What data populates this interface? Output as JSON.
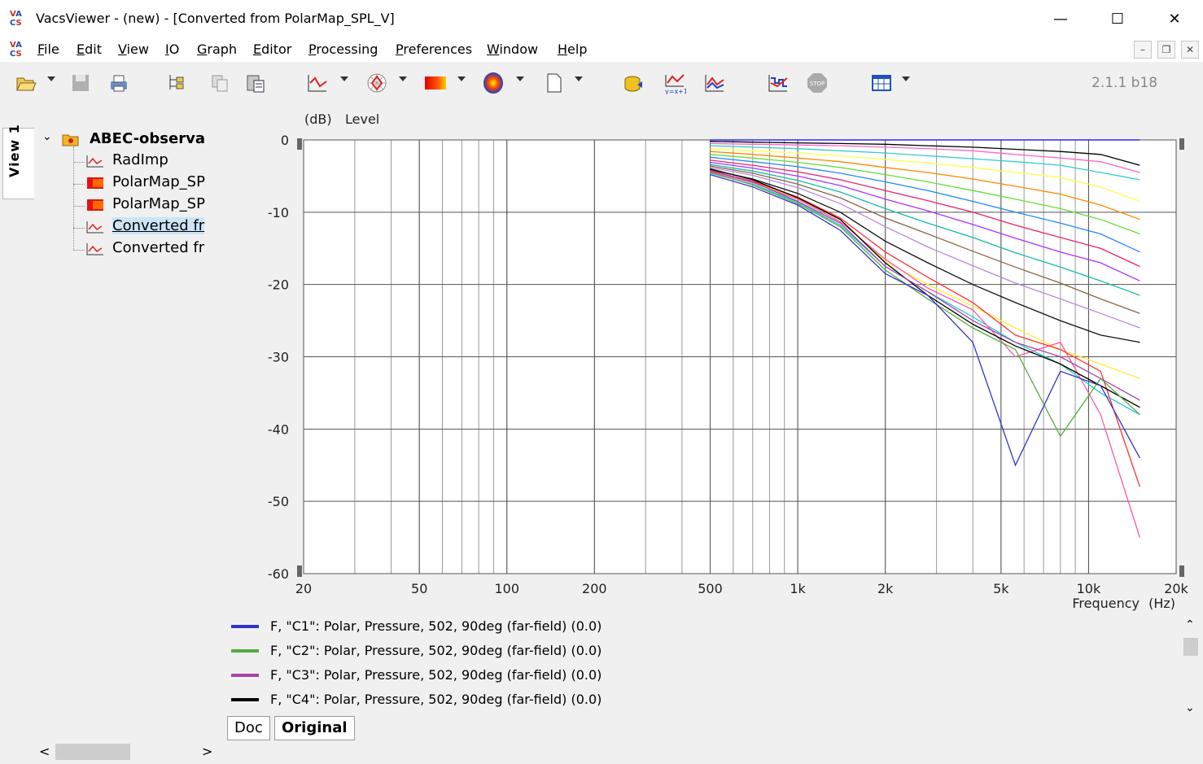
{
  "window": {
    "title": "VacsViewer - (new) - [Converted from PolarMap_SPL_V]",
    "minimize": "—",
    "maximize": "☐",
    "close": "✕"
  },
  "menu": [
    "File",
    "Edit",
    "View",
    "IO",
    "Graph",
    "Editor",
    "Processing",
    "Preferences",
    "Window",
    "Help"
  ],
  "menu_mnemonics": [
    "F",
    "E",
    "V",
    "I",
    "G",
    "E",
    "P",
    "P",
    "W",
    "H"
  ],
  "version": "2.1.1 b18",
  "sidebar": {
    "view_tab": "View 1",
    "tree": [
      {
        "label": "ABEC-observa",
        "type": "folder",
        "selected": false,
        "level": 0
      },
      {
        "label": "RadImp",
        "type": "graph",
        "selected": false,
        "level": 1
      },
      {
        "label": "PolarMap_SP",
        "type": "map",
        "selected": false,
        "level": 1
      },
      {
        "label": "PolarMap_SP",
        "type": "map",
        "selected": false,
        "level": 1
      },
      {
        "label": "Converted fr",
        "type": "graph",
        "selected": true,
        "level": 1
      },
      {
        "label": "Converted fr",
        "type": "graph",
        "selected": false,
        "level": 1
      }
    ]
  },
  "chart_data": {
    "type": "line",
    "ylabel_unit": "(dB)",
    "ylabel": "Level",
    "xlabel": "Frequency",
    "xlabel_unit": "(Hz)",
    "xscale": "log",
    "xlim": [
      20,
      20000
    ],
    "ylim": [
      -60,
      0
    ],
    "x_ticks": [
      "20",
      "50",
      "100",
      "200",
      "500",
      "1k",
      "2k",
      "5k",
      "10k",
      "20k"
    ],
    "x_tick_values": [
      20,
      50,
      100,
      200,
      500,
      1000,
      2000,
      5000,
      10000,
      20000
    ],
    "y_ticks": [
      "0",
      "-10",
      "-20",
      "-30",
      "-40",
      "-50",
      "-60"
    ],
    "y_tick_values": [
      0,
      -10,
      -20,
      -30,
      -40,
      -50,
      -60
    ],
    "grid": true,
    "x": [
      500,
      700,
      1000,
      1400,
      2000,
      2800,
      4000,
      5600,
      8000,
      11000,
      15000
    ],
    "series": [
      {
        "name": "F, \"C1\": Polar, Pressure, 502, 90deg (far-field) (0.0)",
        "color": "#3333cc",
        "values": [
          -4.8,
          -6.5,
          -9.0,
          -12.5,
          -18.5,
          -21.5,
          -28.0,
          -45.0,
          -32.0,
          -34.0,
          -44.0
        ]
      },
      {
        "name": "F, \"C2\": Polar, Pressure, 502, 90deg (far-field) (0.0)",
        "color": "#55aa44",
        "values": [
          -4.5,
          -6.2,
          -8.8,
          -12.0,
          -18.0,
          -22.0,
          -26.0,
          -29.0,
          -41.0,
          -33.0,
          -38.0
        ]
      },
      {
        "name": "F, \"C3\": Polar, Pressure, 502, 90deg (far-field) (0.0)",
        "color": "#aa44aa",
        "values": [
          -4.2,
          -5.8,
          -8.5,
          -11.5,
          -17.5,
          -21.0,
          -25.0,
          -28.0,
          -30.0,
          -33.0,
          -36.0
        ]
      },
      {
        "name": "F, \"C4\": Polar, Pressure, 502, 90deg (far-field) (0.0)",
        "color": "#000000",
        "values": [
          -4.0,
          -5.5,
          -8.0,
          -11.0,
          -17.0,
          -21.5,
          -25.5,
          -28.5,
          -31.0,
          -34.0,
          -37.0
        ]
      },
      {
        "name": "",
        "color": "#0000ff",
        "values": [
          0,
          0,
          0,
          0,
          0,
          0,
          0,
          0,
          0,
          0,
          0
        ]
      },
      {
        "name": "",
        "color": "#000000",
        "values": [
          -0.2,
          -0.3,
          -0.4,
          -0.5,
          -0.6,
          -0.8,
          -1.0,
          -1.3,
          -1.6,
          -2.0,
          -3.5
        ]
      },
      {
        "name": "",
        "color": "#ff66cc",
        "values": [
          -0.5,
          -0.6,
          -0.7,
          -0.8,
          -1.0,
          -1.2,
          -1.5,
          -2.0,
          -2.5,
          -3.0,
          -4.5
        ]
      },
      {
        "name": "",
        "color": "#33cccc",
        "values": [
          -0.8,
          -1.0,
          -1.2,
          -1.5,
          -1.8,
          -2.2,
          -2.6,
          -3.0,
          -3.5,
          -4.5,
          -5.5
        ]
      },
      {
        "name": "",
        "color": "#ffff44",
        "values": [
          -1.2,
          -1.5,
          -1.8,
          -2.2,
          -2.7,
          -3.2,
          -3.8,
          -4.5,
          -5.2,
          -6.5,
          -8.5
        ]
      },
      {
        "name": "",
        "color": "#ff8800",
        "values": [
          -1.6,
          -2.0,
          -2.5,
          -3.0,
          -3.8,
          -4.5,
          -5.4,
          -6.4,
          -7.5,
          -9.0,
          -11.0
        ]
      },
      {
        "name": "",
        "color": "#66dd33",
        "values": [
          -2.0,
          -2.5,
          -3.1,
          -3.8,
          -4.8,
          -5.8,
          -7.0,
          -8.2,
          -9.5,
          -11.0,
          -13.0
        ]
      },
      {
        "name": "",
        "color": "#2288ff",
        "values": [
          -2.4,
          -3.0,
          -3.7,
          -4.6,
          -5.8,
          -7.0,
          -8.5,
          -10.0,
          -11.5,
          -13.0,
          -15.5
        ]
      },
      {
        "name": "",
        "color": "#ee2266",
        "values": [
          -2.8,
          -3.5,
          -4.4,
          -5.5,
          -7.0,
          -8.4,
          -10.0,
          -11.8,
          -13.5,
          -15.0,
          -17.5
        ]
      },
      {
        "name": "",
        "color": "#aa33ff",
        "values": [
          -3.1,
          -3.9,
          -5.0,
          -6.3,
          -8.2,
          -9.8,
          -11.7,
          -13.6,
          -15.5,
          -17.0,
          -19.5
        ]
      },
      {
        "name": "",
        "color": "#11bbaa",
        "values": [
          -3.4,
          -4.3,
          -5.6,
          -7.2,
          -9.5,
          -11.5,
          -13.5,
          -15.6,
          -17.6,
          -19.5,
          -21.5
        ]
      },
      {
        "name": "",
        "color": "#886644",
        "values": [
          -3.6,
          -4.6,
          -6.1,
          -8.0,
          -10.8,
          -13.0,
          -15.4,
          -17.6,
          -19.8,
          -22.0,
          -24.0
        ]
      },
      {
        "name": "",
        "color": "#bb88dd",
        "values": [
          -3.8,
          -4.9,
          -6.6,
          -8.8,
          -12.0,
          -14.8,
          -17.4,
          -19.8,
          -22.0,
          -24.0,
          -26.0
        ]
      },
      {
        "name": "",
        "color": "#111111",
        "values": [
          -4.1,
          -5.4,
          -7.4,
          -10.0,
          -14.0,
          -17.0,
          -20.0,
          -22.5,
          -25.0,
          -27.0,
          -28.0
        ]
      },
      {
        "name": "",
        "color": "#ff3333",
        "values": [
          -4.3,
          -5.7,
          -7.9,
          -10.8,
          -15.5,
          -19.0,
          -22.5,
          -27.0,
          -29.0,
          -32.0,
          -48.0
        ]
      },
      {
        "name": "",
        "color": "#ff55aa",
        "values": [
          -4.4,
          -5.9,
          -8.2,
          -11.3,
          -16.5,
          -20.5,
          -23.5,
          -30.0,
          -28.0,
          -38.0,
          -55.0
        ]
      },
      {
        "name": "",
        "color": "#22cccc",
        "values": [
          -4.6,
          -6.1,
          -8.6,
          -11.8,
          -17.5,
          -21.0,
          -24.5,
          -28.0,
          -31.0,
          -35.0,
          -38.0
        ]
      },
      {
        "name": "",
        "color": "#ffee33",
        "values": [
          -4.3,
          -5.8,
          -8.1,
          -11.0,
          -16.8,
          -20.0,
          -23.0,
          -26.0,
          -29.0,
          -31.0,
          -33.0
        ]
      }
    ]
  },
  "legend_visible_series": [
    0,
    1,
    2,
    3
  ],
  "bottom_tabs": [
    {
      "label": "Doc",
      "active": false
    },
    {
      "label": "Original",
      "active": true
    }
  ],
  "scroll": {
    "left": "<",
    "right": ">",
    "up": "⌃",
    "down": "⌄"
  }
}
